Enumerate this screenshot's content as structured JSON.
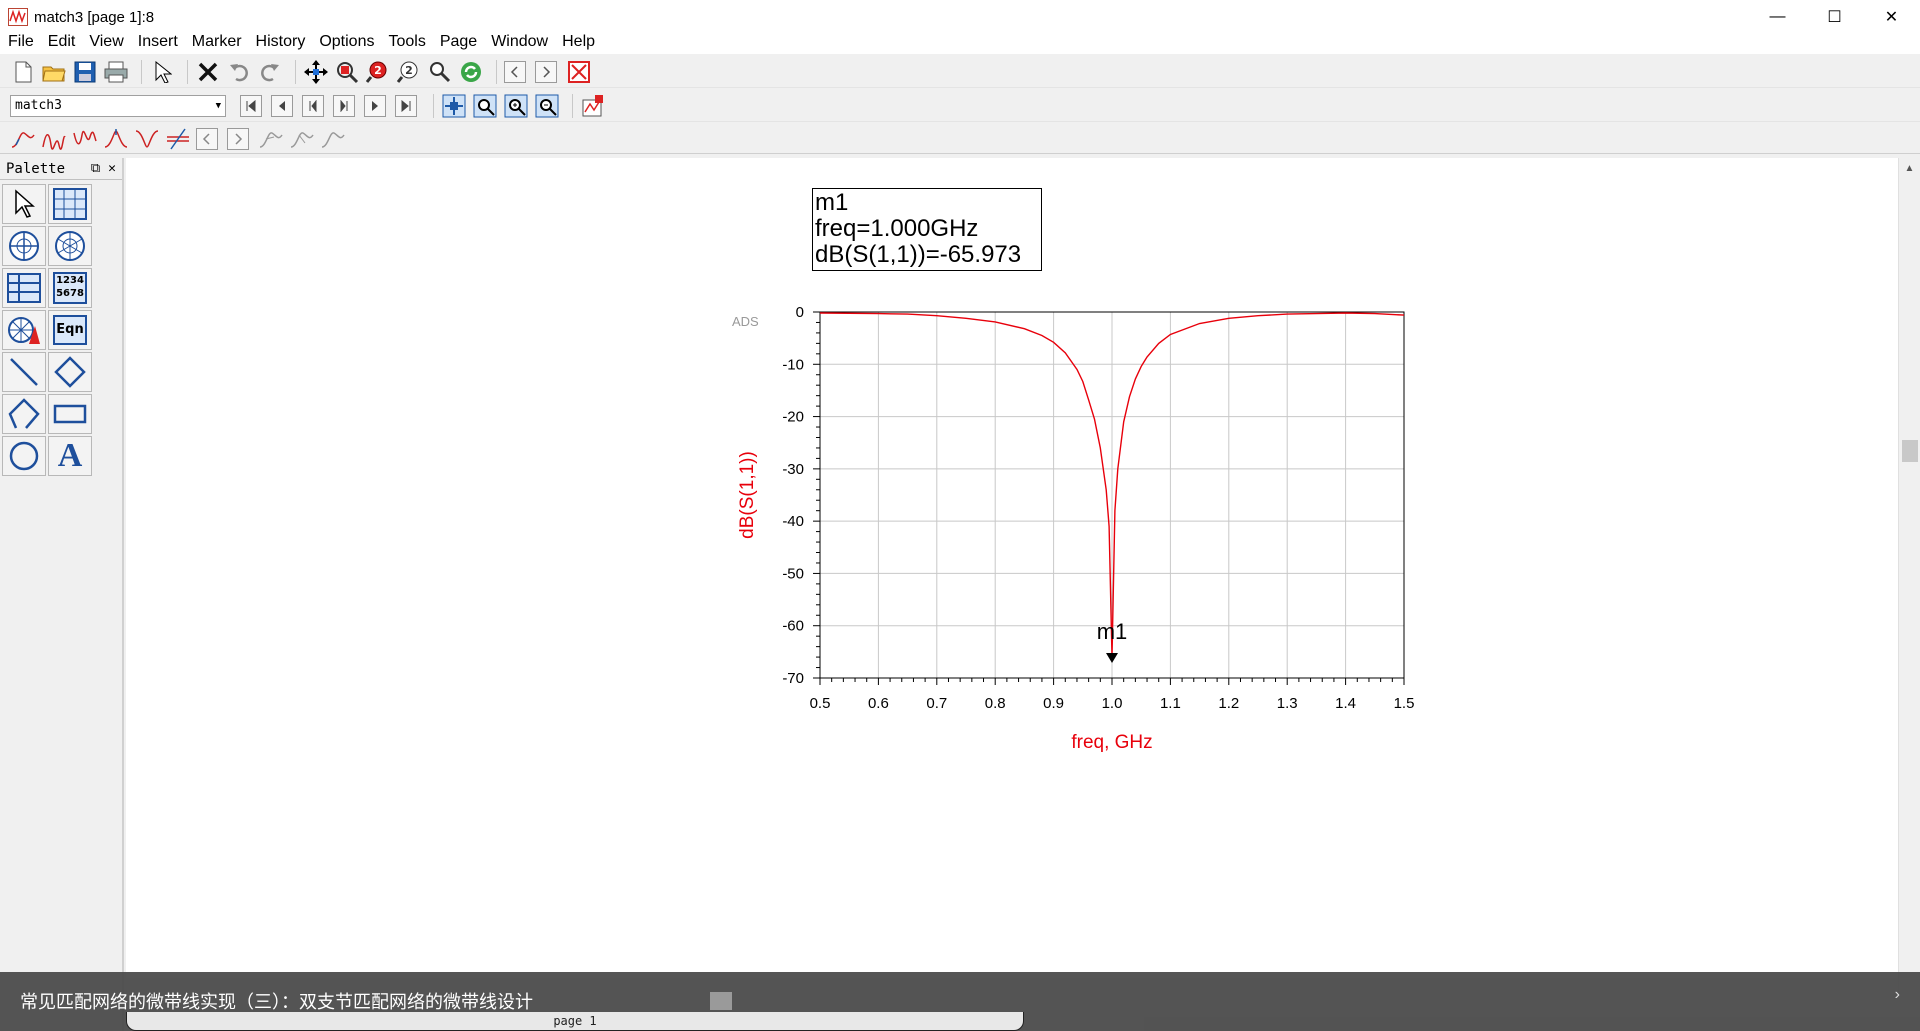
{
  "window": {
    "title": "match3 [page 1]:8",
    "controls": [
      "—",
      "☐",
      "✕"
    ]
  },
  "menu": [
    {
      "label": "File"
    },
    {
      "label": "Edit"
    },
    {
      "label": "View"
    },
    {
      "label": "Insert"
    },
    {
      "label": "Marker"
    },
    {
      "label": "History"
    },
    {
      "label": "Options"
    },
    {
      "label": "Tools"
    },
    {
      "label": "Page"
    },
    {
      "label": "Window"
    },
    {
      "label": "Help"
    }
  ],
  "toolbar2": {
    "dataset_value": "match3"
  },
  "palette": {
    "title": "Palette",
    "icons": [
      "pointer",
      "table-grid",
      "smith-chart",
      "polar-chart",
      "list",
      "numbers-1234-5678",
      "antenna-plot",
      "eqn",
      "line",
      "polygon",
      "polyline",
      "rectangle",
      "circle",
      "text-A"
    ],
    "numbers_label": "1234\n5678",
    "eqn_label": "Eqn",
    "text_label": "A"
  },
  "marker": {
    "name": "m1",
    "line1": "freq=1.000GHz",
    "line2": "dB(S(1,1))=-65.973",
    "plot_label": "m1"
  },
  "chart_data": {
    "type": "line",
    "watermark": "ADS",
    "xlabel": "freq, GHz",
    "ylabel": "dB(S(1,1))",
    "xlim": [
      0.5,
      1.5
    ],
    "ylim": [
      -70,
      0
    ],
    "x_ticks": [
      0.5,
      0.6,
      0.7,
      0.8,
      0.9,
      1.0,
      1.1,
      1.2,
      1.3,
      1.4,
      1.5
    ],
    "x_tick_labels": [
      "0.5",
      "0.6",
      "0.7",
      "0.8",
      "0.9",
      "1.0",
      "1.1",
      "1.2",
      "1.3",
      "1.4",
      "1.5"
    ],
    "y_ticks": [
      0,
      -10,
      -20,
      -30,
      -40,
      -50,
      -60,
      -70
    ],
    "y_tick_labels": [
      "0",
      "-10",
      "-20",
      "-30",
      "-40",
      "-50",
      "-60",
      "-70"
    ],
    "grid": true,
    "series": [
      {
        "color": "#e8000b",
        "x": [
          0.5,
          0.6,
          0.65,
          0.7,
          0.75,
          0.8,
          0.85,
          0.88,
          0.9,
          0.92,
          0.94,
          0.95,
          0.96,
          0.97,
          0.98,
          0.99,
          0.995,
          1.0,
          1.005,
          1.01,
          1.02,
          1.03,
          1.04,
          1.05,
          1.06,
          1.08,
          1.1,
          1.15,
          1.2,
          1.25,
          1.3,
          1.35,
          1.4,
          1.45,
          1.5
        ],
        "y": [
          -0.2,
          -0.3,
          -0.4,
          -0.7,
          -1.2,
          -1.9,
          -3.2,
          -4.5,
          -5.8,
          -7.8,
          -11.0,
          -13.3,
          -16.8,
          -20.5,
          -26.0,
          -34.0,
          -41.0,
          -65.973,
          -38.0,
          -30.0,
          -21.0,
          -16.2,
          -12.8,
          -10.4,
          -8.6,
          -6.0,
          -4.3,
          -2.2,
          -1.2,
          -0.7,
          -0.4,
          -0.3,
          -0.2,
          -0.3,
          -0.6
        ]
      }
    ],
    "marker": {
      "x": 1.0,
      "y": -65.973,
      "label": "m1"
    }
  },
  "footer": {
    "caption": "常见匹配网络的微带线实现（三）：双支节匹配网络的微带线设计",
    "page_tab": "page 1"
  }
}
